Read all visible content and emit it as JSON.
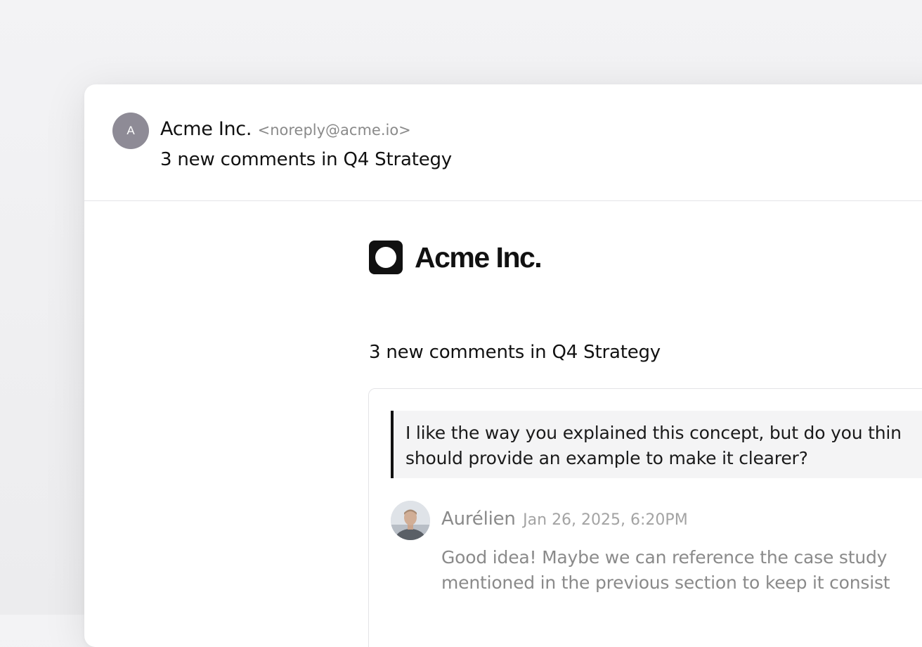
{
  "header": {
    "avatar_initial": "A",
    "sender_name": "Acme Inc.",
    "sender_email": "<noreply@acme.io>",
    "subject": "3 new comments in Q4 Strategy"
  },
  "body": {
    "brand_name": "Acme Inc.",
    "summary_prefix": "3 new comments in ",
    "summary_doc": "Q4 Strategy",
    "comment": {
      "quote": [
        "I like the way you explained this concept, but do you thin",
        "should provide an example to make it clearer?"
      ],
      "author": "Aurélien",
      "timestamp": "Jan 26, 2025, 6:20PM",
      "text": [
        "Good idea! Maybe we can reference the case study",
        "mentioned in the previous section to keep it consist"
      ]
    }
  },
  "colors": {
    "background": "#f3f3f5",
    "card": "#ffffff",
    "avatar": "#8e8b96",
    "quote_bg": "#f4f4f5",
    "quote_border": "#111111",
    "muted_text": "#8a8a8a"
  }
}
